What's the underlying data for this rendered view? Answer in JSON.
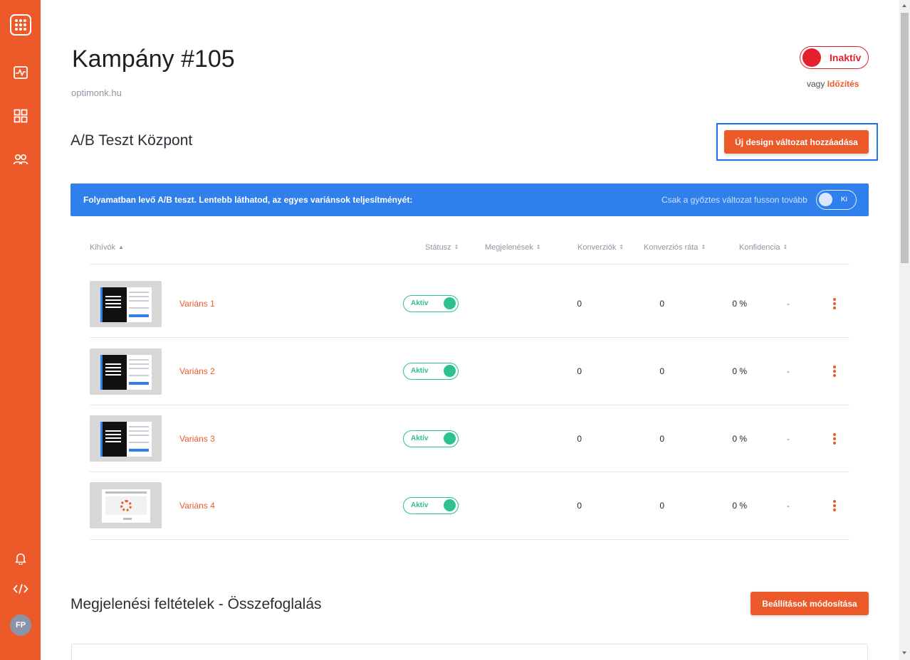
{
  "sidebar": {
    "logo": "grid-logo-icon",
    "items": [
      {
        "icon": "analytics-icon"
      },
      {
        "icon": "dashboard-grid-icon"
      },
      {
        "icon": "users-icon"
      }
    ],
    "bottom": [
      {
        "icon": "bell-icon"
      },
      {
        "icon": "code-icon"
      }
    ],
    "avatar_initials": "FP",
    "color": "#ed5a29"
  },
  "header": {
    "title": "Kampány #105",
    "domain": "optimonk.hu",
    "status": "Inaktív",
    "or_text": "vagy",
    "schedule_link": "Időzítés"
  },
  "ab": {
    "heading": "A/B Teszt Központ",
    "add_button": "Új design változat hozzáadása",
    "banner_message": "Folyamatban levő A/B teszt. Lentebb láthatod, az egyes variánsok teljesítményét:",
    "winner_label": "Csak a győztes változat fusson tovább",
    "winner_toggle": "Ki",
    "columns": {
      "challenger": "Kihívók",
      "status": "Státusz",
      "impressions": "Megjelenések",
      "conversions": "Konverziók",
      "rate": "Konverziós ráta",
      "confidence": "Konfidencia"
    },
    "rows": [
      {
        "name": "Variáns 1",
        "status": "Aktív",
        "impressions": "0",
        "conversions": "0",
        "rate": "0 %",
        "confidence": "-"
      },
      {
        "name": "Variáns 2",
        "status": "Aktív",
        "impressions": "0",
        "conversions": "0",
        "rate": "0 %",
        "confidence": "-"
      },
      {
        "name": "Variáns 3",
        "status": "Aktív",
        "impressions": "0",
        "conversions": "0",
        "rate": "0 %",
        "confidence": "-"
      },
      {
        "name": "Variáns 4",
        "status": "Aktív",
        "impressions": "0",
        "conversions": "0",
        "rate": "0 %",
        "confidence": "-"
      }
    ]
  },
  "display": {
    "heading": "Megjelenési feltételek - Összefoglalás",
    "settings_button": "Beállítások módosítása"
  },
  "colors": {
    "accent": "#ed5a29",
    "info": "#2f80ed",
    "active": "#2cc18e",
    "inactive": "#e4202f"
  }
}
